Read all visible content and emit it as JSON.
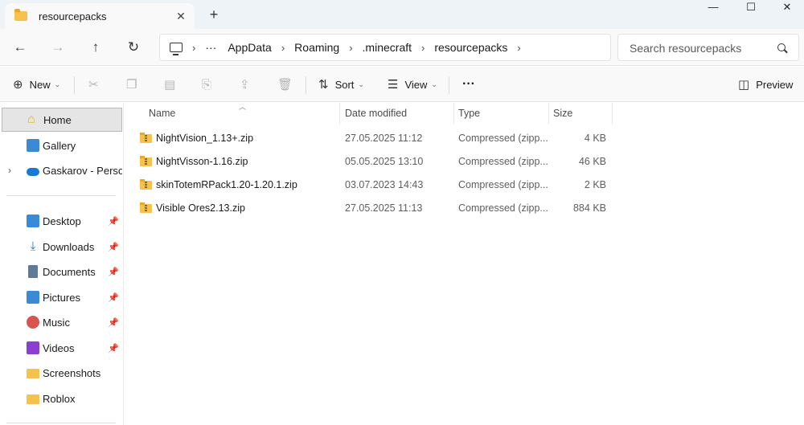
{
  "window": {
    "tab_title": "resourcepacks",
    "tab_close": "✕",
    "new_tab": "+",
    "minimize": "—",
    "maximize": "☐",
    "close": "✕"
  },
  "nav": {
    "back": "←",
    "forward": "→",
    "up": "↑",
    "refresh": "↻",
    "more": "···",
    "separator": "›",
    "breadcrumbs": [
      "AppData",
      "Roaming",
      ".minecraft",
      "resourcepacks"
    ],
    "search_placeholder": "Search resourcepacks"
  },
  "toolbar": {
    "new_label": "New",
    "sort_label": "Sort",
    "view_label": "View",
    "more_label": "···",
    "preview_label": "Preview"
  },
  "sidebar": {
    "home": "Home",
    "gallery": "Gallery",
    "onedrive": "Gaskarov - Personal",
    "quick_access": [
      {
        "label": "Desktop",
        "icon": "desktop-icon",
        "pinned": true
      },
      {
        "label": "Downloads",
        "icon": "download-icon",
        "pinned": true
      },
      {
        "label": "Documents",
        "icon": "document-icon",
        "pinned": true
      },
      {
        "label": "Pictures",
        "icon": "pictures-icon",
        "pinned": true
      },
      {
        "label": "Music",
        "icon": "music-icon",
        "pinned": true
      },
      {
        "label": "Videos",
        "icon": "video-icon",
        "pinned": true
      },
      {
        "label": "Screenshots",
        "icon": "folder-icon",
        "pinned": false
      },
      {
        "label": "Roblox",
        "icon": "folder-icon",
        "pinned": false
      }
    ]
  },
  "list": {
    "columns": {
      "name": "Name",
      "date": "Date modified",
      "type": "Type",
      "size": "Size"
    },
    "rows": [
      {
        "name": "NightVision_1.13+.zip",
        "date": "27.05.2025 11:12",
        "type": "Compressed (zipp...",
        "size": "4 KB"
      },
      {
        "name": "NightVisson-1.16.zip",
        "date": "05.05.2025 13:10",
        "type": "Compressed (zipp...",
        "size": "46 KB"
      },
      {
        "name": "skinTotemRPack1.20-1.20.1.zip",
        "date": "03.07.2023 14:43",
        "type": "Compressed (zipp...",
        "size": "2 KB"
      },
      {
        "name": "Visible Ores2.13.zip",
        "date": "27.05.2025 11:13",
        "type": "Compressed (zipp...",
        "size": "884 KB"
      }
    ]
  },
  "colors": {
    "folder": "#f8c04d",
    "accent": "#1679d3",
    "titlebar": "#eef3f8"
  }
}
